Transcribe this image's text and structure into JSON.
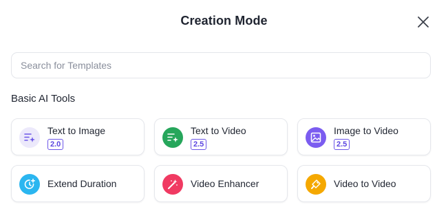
{
  "dialog": {
    "title": "Creation Mode"
  },
  "search": {
    "placeholder": "Search for Templates",
    "value": ""
  },
  "section": {
    "title": "Basic AI Tools"
  },
  "tools": [
    {
      "label": "Text to Image",
      "badge": "2.0",
      "icon": "text-sparkle-icon",
      "color": "#ece9fb"
    },
    {
      "label": "Text to Video",
      "badge": "2.5",
      "icon": "text-sparkle-icon",
      "color": "#26a65b"
    },
    {
      "label": "Image to Video",
      "badge": "2.5",
      "icon": "image-icon",
      "color": "#7b5cf0"
    },
    {
      "label": "Extend Duration",
      "icon": "timer-plus-icon",
      "color": "#2bb6f0"
    },
    {
      "label": "Video Enhancer",
      "icon": "magic-wand-icon",
      "color": "#f03a62"
    },
    {
      "label": "Video to Video",
      "icon": "brush-icon",
      "color": "#f5a800"
    }
  ]
}
